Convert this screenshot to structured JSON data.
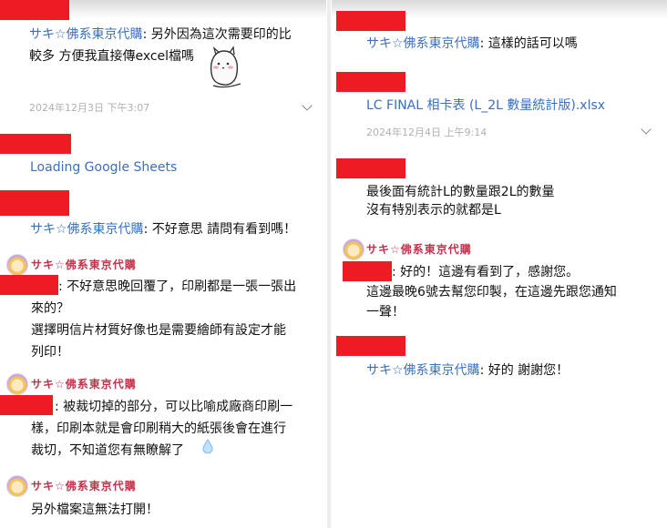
{
  "left": {
    "m1": {
      "sender": "サキ☆佛系東京代購",
      "sep": ": ",
      "line1": "另外因為這次需要印的比",
      "line2": "較多 方便我直接傳excel檔嗎"
    },
    "ts1": "2024年12月3日 下午3:07",
    "link1": "Loading Google Sheets",
    "m2": {
      "sender": "サキ☆佛系東京代購",
      "text": ": 不好意思 請問有看到嗎！"
    },
    "name1": "サキ☆佛系東京代購",
    "m3": {
      "line1": ": 不好意思晚回覆了，印刷都是一張一張出",
      "line2": "來的？",
      "line3": "選擇明信片材質好像也是需要繪師有設定才能",
      "line4": "列印！"
    },
    "name2": "サキ☆佛系東京代購",
    "m4": {
      "line1": ": 被裁切掉的部分，可以比喻成廠商印刷一",
      "line2": "樣，印刷本就是會印刷稍大的紙張後會在進行",
      "line3": "裁切，不知道您有無瞭解了"
    },
    "name3": "サキ☆佛系東京代購",
    "m5": "另外檔案這無法打開！"
  },
  "right": {
    "m1": {
      "sender": "サキ☆佛系東京代購",
      "text": ": 這樣的話可以嗎"
    },
    "file": "LC FINAL 相卡表 (L_2L 數量統計版).xlsx",
    "ts": "2024年12月4日 上午9:14",
    "m2": {
      "line1": "最後面有統計L的數量跟2L的數量",
      "line2": "沒有特別表示的就都是L"
    },
    "name": "サキ☆佛系東京代購",
    "m3": {
      "line1": ": 好的！這邊有看到了，感謝您。",
      "line2": "這邊最晚6號去幫您印製，在這邊先跟您通知",
      "line3": "一聲！"
    },
    "m4": {
      "sender": "サキ☆佛系東京代購",
      "text": ": 好的 謝謝您！"
    }
  },
  "colors": {
    "redaction": "#ee1b24",
    "sender_blue": "#3a6fc4",
    "name_red": "#c0334a",
    "timestamp": "#b0b0b0"
  },
  "icons": [
    "chevron-down-icon",
    "avatar",
    "cat-sticker",
    "sweat-drop-emoji"
  ]
}
